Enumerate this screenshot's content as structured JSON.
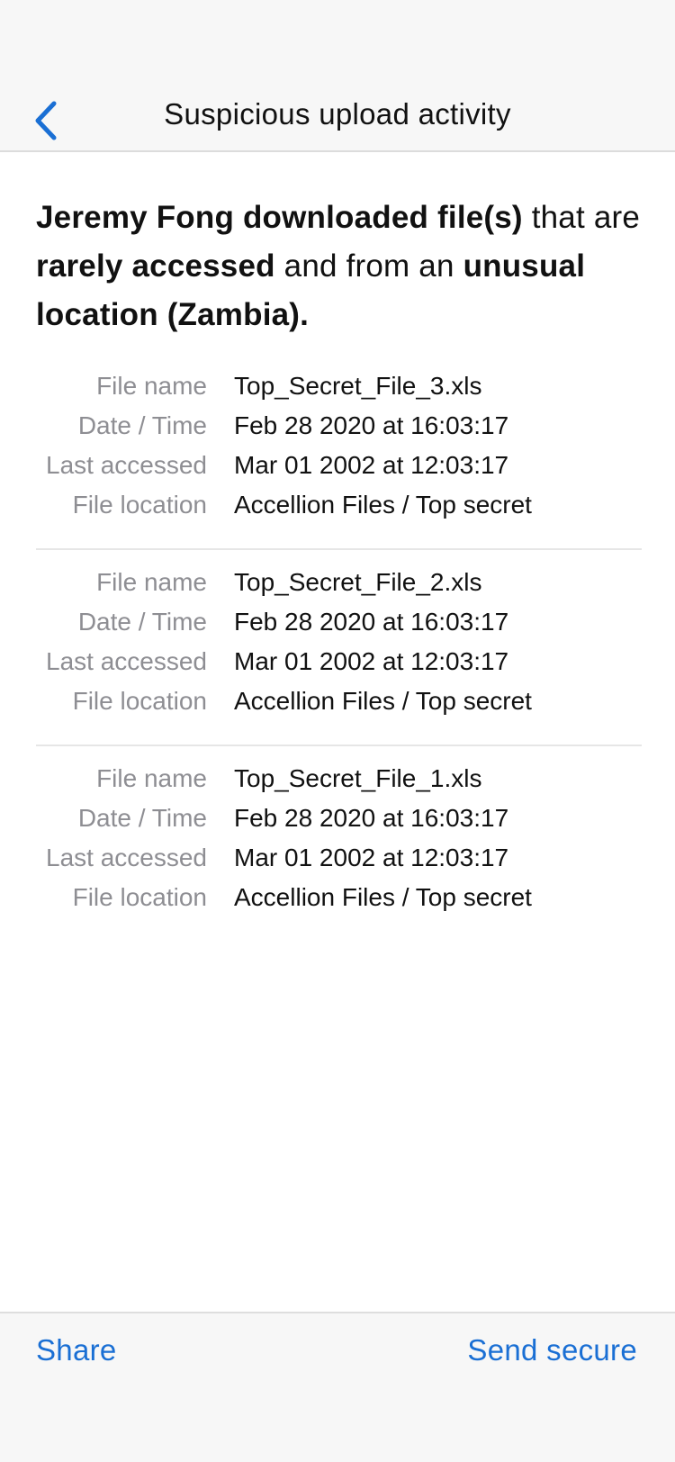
{
  "header": {
    "title": "Suspicious upload activity",
    "back_icon": "chevron-left-icon",
    "accent_color": "#1a6fd4"
  },
  "summary": {
    "part1_bold": "Jeremy Fong downloaded file(s)",
    "part2": " that are ",
    "part3_bold": "rarely accessed",
    "part4": " and from an ",
    "part5_bold": "unusual location (Zambia)."
  },
  "labels": {
    "file_name": "File name",
    "date_time": "Date / Time",
    "last_accessed": "Last accessed",
    "file_location": "File location"
  },
  "files": [
    {
      "file_name": "Top_Secret_File_3.xls",
      "date_time": "Feb 28 2020 at 16:03:17",
      "last_accessed": "Mar 01 2002 at 12:03:17",
      "file_location": "Accellion Files / Top secret"
    },
    {
      "file_name": "Top_Secret_File_2.xls",
      "date_time": "Feb 28 2020 at 16:03:17",
      "last_accessed": "Mar 01 2002 at 12:03:17",
      "file_location": "Accellion Files / Top secret"
    },
    {
      "file_name": "Top_Secret_File_1.xls",
      "date_time": "Feb 28 2020 at 16:03:17",
      "last_accessed": "Mar 01 2002 at 12:03:17",
      "file_location": "Accellion Files / Top secret"
    }
  ],
  "toolbar": {
    "share_label": "Share",
    "send_secure_label": "Send secure"
  }
}
